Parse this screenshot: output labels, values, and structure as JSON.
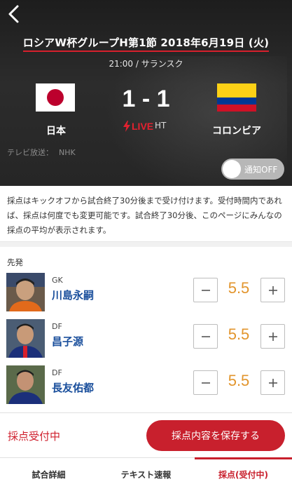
{
  "header": {
    "match_title": "ロシアW杯グループH第1節 2018年6月19日 (火)",
    "time_venue": "21:00 / サランスク"
  },
  "match": {
    "home_team": "日本",
    "away_team": "コロンビア",
    "score": "1 - 1",
    "live_label": "LIVE",
    "period": "HT"
  },
  "broadcast": {
    "label": "テレビ放送：",
    "channel": "NHK"
  },
  "notification": {
    "label": "通知OFF",
    "enabled": false
  },
  "notice": {
    "text": "採点はキックオフから試合終了30分後まで受け付けます。受付時間内であれば、採点は何度でも変更可能です。試合終了30分後、このページにみんなの採点の平均が表示されます。"
  },
  "lineup": {
    "section_label": "先発",
    "players": [
      {
        "position": "GK",
        "name": "川島永嗣",
        "score": "5.5"
      },
      {
        "position": "DF",
        "name": "昌子源",
        "score": "5.5"
      },
      {
        "position": "DF",
        "name": "長友佑都",
        "score": "5.5"
      }
    ]
  },
  "footer": {
    "status": "採点受付中",
    "save_label": "採点内容を保存する"
  },
  "tabs": [
    {
      "label": "試合詳細",
      "active": false
    },
    {
      "label": "テキスト速報",
      "active": false
    },
    {
      "label": "採点(受付中)",
      "active": true
    }
  ],
  "colors": {
    "accent": "#c8202d",
    "score_value": "#e2952d",
    "player_name": "#1a4f9c"
  },
  "icons": {
    "back": "chevron-left-icon",
    "live": "lightning-icon",
    "minus": "minus-icon",
    "plus": "plus-icon"
  }
}
